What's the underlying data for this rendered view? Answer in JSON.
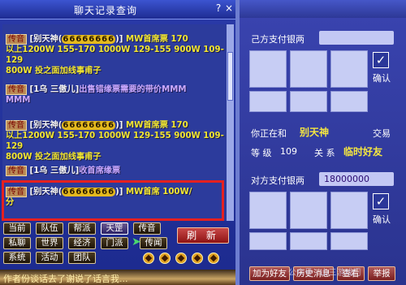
{
  "chat_window": {
    "title": "聊天记录查询",
    "help": "?",
    "close": "×",
    "messages": [
      {
        "tag": "传音",
        "sender": "[别天神(",
        "num": "66666666",
        "close": ")]",
        "body": "MW首席票 170",
        "line2": "以上1200W 155-170 1000W 129-155 900W 109-129",
        "line3": "800W 投之面加线事甫子"
      },
      {
        "tag": "传音",
        "sender": "[1乌 三傲儿]",
        "body": "出售错缘票需要的带价MMM",
        "line2": "MMM"
      },
      {
        "tag": "传音",
        "sender": "[别天神(",
        "num": "66666666",
        "close": ")]",
        "body": "MW首席票 170",
        "line2": "以上1200W 155-170 1000W 129-155 900W 109-129",
        "line3": "800W 投之面加线事甫子"
      },
      {
        "tag": "传音",
        "sender": "[1乌 三傲儿]",
        "body": "收首席缘票"
      },
      {
        "tag": "传音",
        "sender": "[别天神(",
        "num": "66666666",
        "close": ")]",
        "body": "MW首席 100W/",
        "line2": "分"
      }
    ],
    "tabs": [
      {
        "label": "当前"
      },
      {
        "label": "队伍"
      },
      {
        "label": "帮派"
      },
      {
        "label": "天罡"
      },
      {
        "label": "传音"
      },
      {
        "label": "私聊"
      },
      {
        "label": "世界"
      },
      {
        "label": "经济"
      },
      {
        "label": "门派"
      },
      {
        "label": "传闻"
      },
      {
        "label": "系统"
      },
      {
        "label": "活动"
      },
      {
        "label": "团队"
      }
    ],
    "refresh": "刷 新",
    "bottom_text": "作者份谈话去了谢说了话言我..."
  },
  "trade_window": {
    "own_money_label": "己方支付银两",
    "own_money_value": "",
    "confirm": "确认",
    "trading_with_prefix": "你正在和",
    "partner_name": "别天神",
    "trade_label": "交易",
    "level_label": "等 级",
    "level_value": "109",
    "relation_label": "关 系",
    "relation_value": "临时好友",
    "other_money_label": "对方支付银两",
    "other_money_value": "18000000",
    "confirm2": "确认",
    "buttons": [
      {
        "label": "加为好友"
      },
      {
        "label": "历史消息"
      },
      {
        "label": "查看"
      },
      {
        "label": "举报"
      }
    ],
    "watermark": "公众号 · 山三游戏门"
  },
  "colors": {
    "highlight_box": "#e52020",
    "message_text": "#f2e630",
    "panel_bg": "#2c3b9c"
  }
}
